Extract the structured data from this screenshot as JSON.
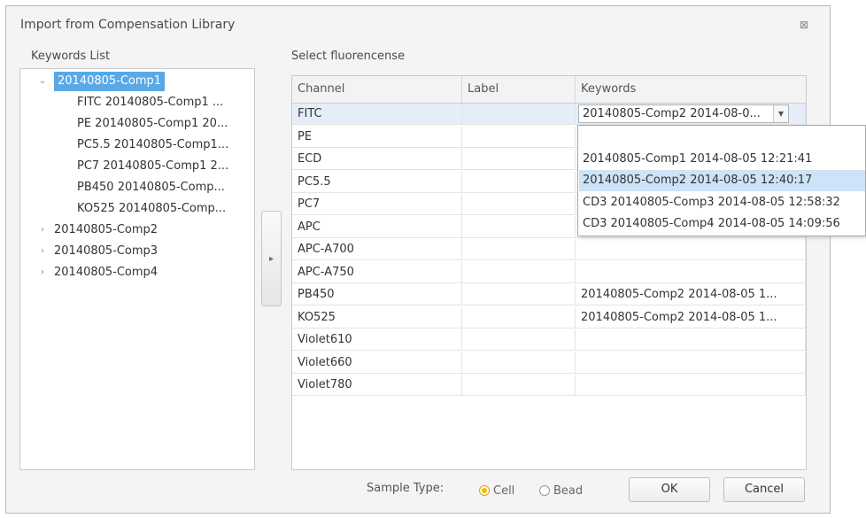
{
  "dialog": {
    "title": "Import from Compensation Library",
    "close_glyph": "⊠"
  },
  "keywords": {
    "label": "Keywords List",
    "groups": [
      {
        "label": "20140805-Comp1",
        "expanded": true,
        "selected": true,
        "children": [
          "FITC 20140805-Comp1 ...",
          "PE 20140805-Comp1 20...",
          "PC5.5 20140805-Comp1...",
          "PC7 20140805-Comp1 2...",
          "PB450 20140805-Comp...",
          "KO525 20140805-Comp..."
        ]
      },
      {
        "label": "20140805-Comp2",
        "expanded": false
      },
      {
        "label": "20140805-Comp3",
        "expanded": false
      },
      {
        "label": "20140805-Comp4",
        "expanded": false
      }
    ]
  },
  "transfer_button": {
    "glyph": "▸"
  },
  "fluorescence": {
    "label": "Select fluorencense",
    "columns": [
      "Channel",
      "Label",
      "Keywords"
    ],
    "rows": [
      {
        "channel": "FITC",
        "label": "",
        "keywords": "20140805-Comp2 2014-08-0..."
      },
      {
        "channel": "PE",
        "label": "",
        "keywords": ""
      },
      {
        "channel": "ECD",
        "label": "",
        "keywords": ""
      },
      {
        "channel": "PC5.5",
        "label": "",
        "keywords": ""
      },
      {
        "channel": "PC7",
        "label": "",
        "keywords": ""
      },
      {
        "channel": "APC",
        "label": "",
        "keywords": ""
      },
      {
        "channel": "APC-A700",
        "label": "",
        "keywords": ""
      },
      {
        "channel": "APC-A750",
        "label": "",
        "keywords": ""
      },
      {
        "channel": "PB450",
        "label": "",
        "keywords": "20140805-Comp2 2014-08-05 1..."
      },
      {
        "channel": "KO525",
        "label": "",
        "keywords": "20140805-Comp2 2014-08-05 1..."
      },
      {
        "channel": "Violet610",
        "label": "",
        "keywords": ""
      },
      {
        "channel": "Violet660",
        "label": "",
        "keywords": ""
      },
      {
        "channel": "Violet780",
        "label": "",
        "keywords": ""
      }
    ],
    "dropdown_options": [
      "",
      "20140805-Comp1 2014-08-05 12:21:41",
      "20140805-Comp2 2014-08-05 12:40:17",
      "CD3 20140805-Comp3 2014-08-05 12:58:32",
      "CD3 20140805-Comp4 2014-08-05 14:09:56"
    ],
    "dropdown_highlight_index": 2
  },
  "footer": {
    "sample_type_label": "Sample Type:",
    "options": [
      {
        "label": "Cell",
        "selected": true
      },
      {
        "label": "Bead",
        "selected": false
      }
    ],
    "ok_label": "OK",
    "cancel_label": "Cancel"
  }
}
